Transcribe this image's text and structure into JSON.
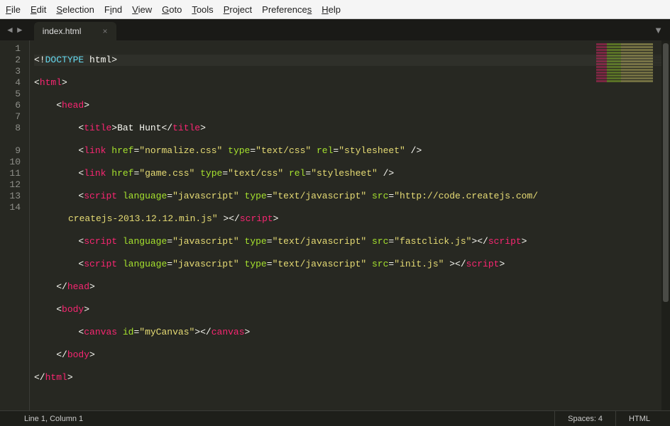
{
  "menu": [
    "File",
    "Edit",
    "Selection",
    "Find",
    "View",
    "Goto",
    "Tools",
    "Project",
    "Preferences",
    "Help"
  ],
  "tab": {
    "name": "index.html"
  },
  "gutter": [
    "1",
    "2",
    "3",
    "4",
    "5",
    "6",
    "7",
    "8",
    "9",
    "10",
    "11",
    "12",
    "13",
    "14"
  ],
  "code": {
    "l1": {
      "pre": "<!",
      "doctype": "DOCTYPE",
      "post": " html>"
    },
    "l2": {
      "open": "<",
      "tag": "html",
      "close": ">"
    },
    "l3": {
      "indent": "    ",
      "open": "<",
      "tag": "head",
      "close": ">"
    },
    "l4": {
      "indent": "        ",
      "open": "<",
      "tag": "title",
      "close": ">",
      "text": "Bat Hunt",
      "open2": "</",
      "tag2": "title",
      "close2": ">"
    },
    "l5": {
      "indent": "        ",
      "open": "<",
      "tag": "link",
      "sp": " ",
      "a1": "href",
      "eq": "=",
      "v1": "\"normalize.css\"",
      "sp2": " ",
      "a2": "type",
      "v2": "\"text/css\"",
      "sp3": " ",
      "a3": "rel",
      "v3": "\"stylesheet\"",
      "end": " />"
    },
    "l6": {
      "indent": "        ",
      "open": "<",
      "tag": "link",
      "sp": " ",
      "a1": "href",
      "eq": "=",
      "v1": "\"game.css\"",
      "sp2": " ",
      "a2": "type",
      "v2": "\"text/css\"",
      "sp3": " ",
      "a3": "rel",
      "v3": "\"stylesheet\"",
      "end": " />"
    },
    "l7": {
      "indent": "        ",
      "open": "<",
      "tag": "script",
      "sp": " ",
      "a1": "language",
      "eq": "=",
      "v1": "\"javascript\"",
      "sp2": " ",
      "a2": "type",
      "v2": "\"text/javascript\"",
      "sp3": " ",
      "a3": "src",
      "v3": "\"http://code.createjs.com/"
    },
    "l7b": {
      "cont": "createjs-2013.12.12.min.js\"",
      "end": " >",
      "open2": "</",
      "tag2": "script",
      "close2": ">"
    },
    "l8": {
      "indent": "        ",
      "open": "<",
      "tag": "script",
      "sp": " ",
      "a1": "language",
      "eq": "=",
      "v1": "\"javascript\"",
      "sp2": " ",
      "a2": "type",
      "v2": "\"text/javascript\"",
      "sp3": " ",
      "a3": "src",
      "v3": "\"fastclick.js\"",
      "end": ">",
      "open2": "</",
      "tag2": "script",
      "close2": ">"
    },
    "l9": {
      "indent": "        ",
      "open": "<",
      "tag": "script",
      "sp": " ",
      "a1": "language",
      "eq": "=",
      "v1": "\"javascript\"",
      "sp2": " ",
      "a2": "type",
      "v2": "\"text/javascript\"",
      "sp3": " ",
      "a3": "src",
      "v3": "\"init.js\"",
      "end": " >",
      "open2": "</",
      "tag2": "script",
      "close2": ">"
    },
    "l10": {
      "indent": "    ",
      "open": "</",
      "tag": "head",
      "close": ">"
    },
    "l11": {
      "indent": "    ",
      "open": "<",
      "tag": "body",
      "close": ">"
    },
    "l12": {
      "indent": "        ",
      "open": "<",
      "tag": "canvas",
      "sp": " ",
      "a1": "id",
      "eq": "=",
      "v1": "\"myCanvas\"",
      "end": ">",
      "open2": "</",
      "tag2": "canvas",
      "close2": ">"
    },
    "l13": {
      "indent": "    ",
      "open": "</",
      "tag": "body",
      "close": ">"
    },
    "l14": {
      "open": "</",
      "tag": "html",
      "close": ">"
    }
  },
  "status": {
    "position": "Line 1, Column 1",
    "spaces": "Spaces: 4",
    "syntax": "HTML"
  }
}
